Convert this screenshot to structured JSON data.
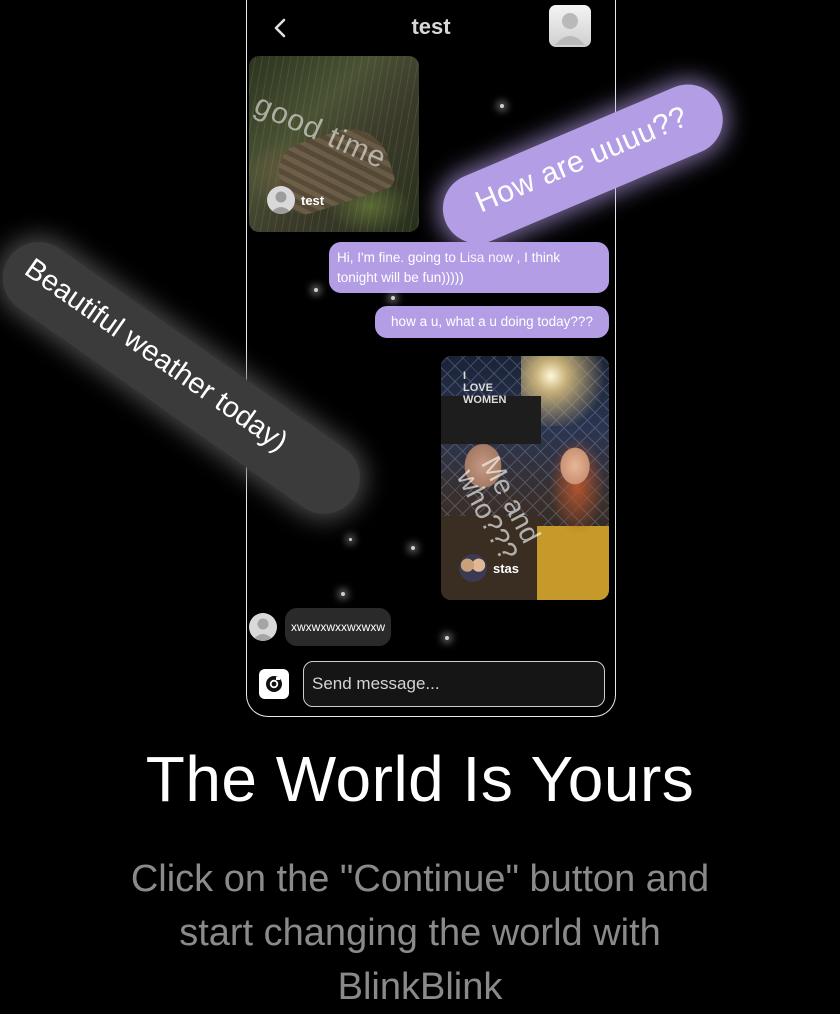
{
  "header": {
    "title": "test",
    "back_icon": "chevron-left-icon",
    "avatar_icon": "user-avatar-icon"
  },
  "messages": {
    "photo1": {
      "caption": "good time",
      "sender": "test"
    },
    "bubble1": "Hi, I'm fine. going to Lisa now , I think tonight will be fun)))))",
    "bubble2": "how a u, what a u doing today???",
    "photo2": {
      "hat_text": "I\nLOVE\nWOMEN",
      "caption": "Me and\nwho???",
      "sender": "stas"
    },
    "incoming": "xwxwxwxxwxwxw"
  },
  "input": {
    "placeholder": "Send message...",
    "camera_icon": "camera-icon"
  },
  "stickers": {
    "purple": "How are uuuu??",
    "gray": "Beautiful weather today)"
  },
  "onboarding": {
    "headline": "The World Is Yours",
    "subtitle": "Click on the \"Continue\" button and start changing the world with BlinkBlink"
  },
  "colors": {
    "accent_purple": "#b39ee6",
    "bubble_in": "#2a2a2a",
    "background": "#000000"
  }
}
